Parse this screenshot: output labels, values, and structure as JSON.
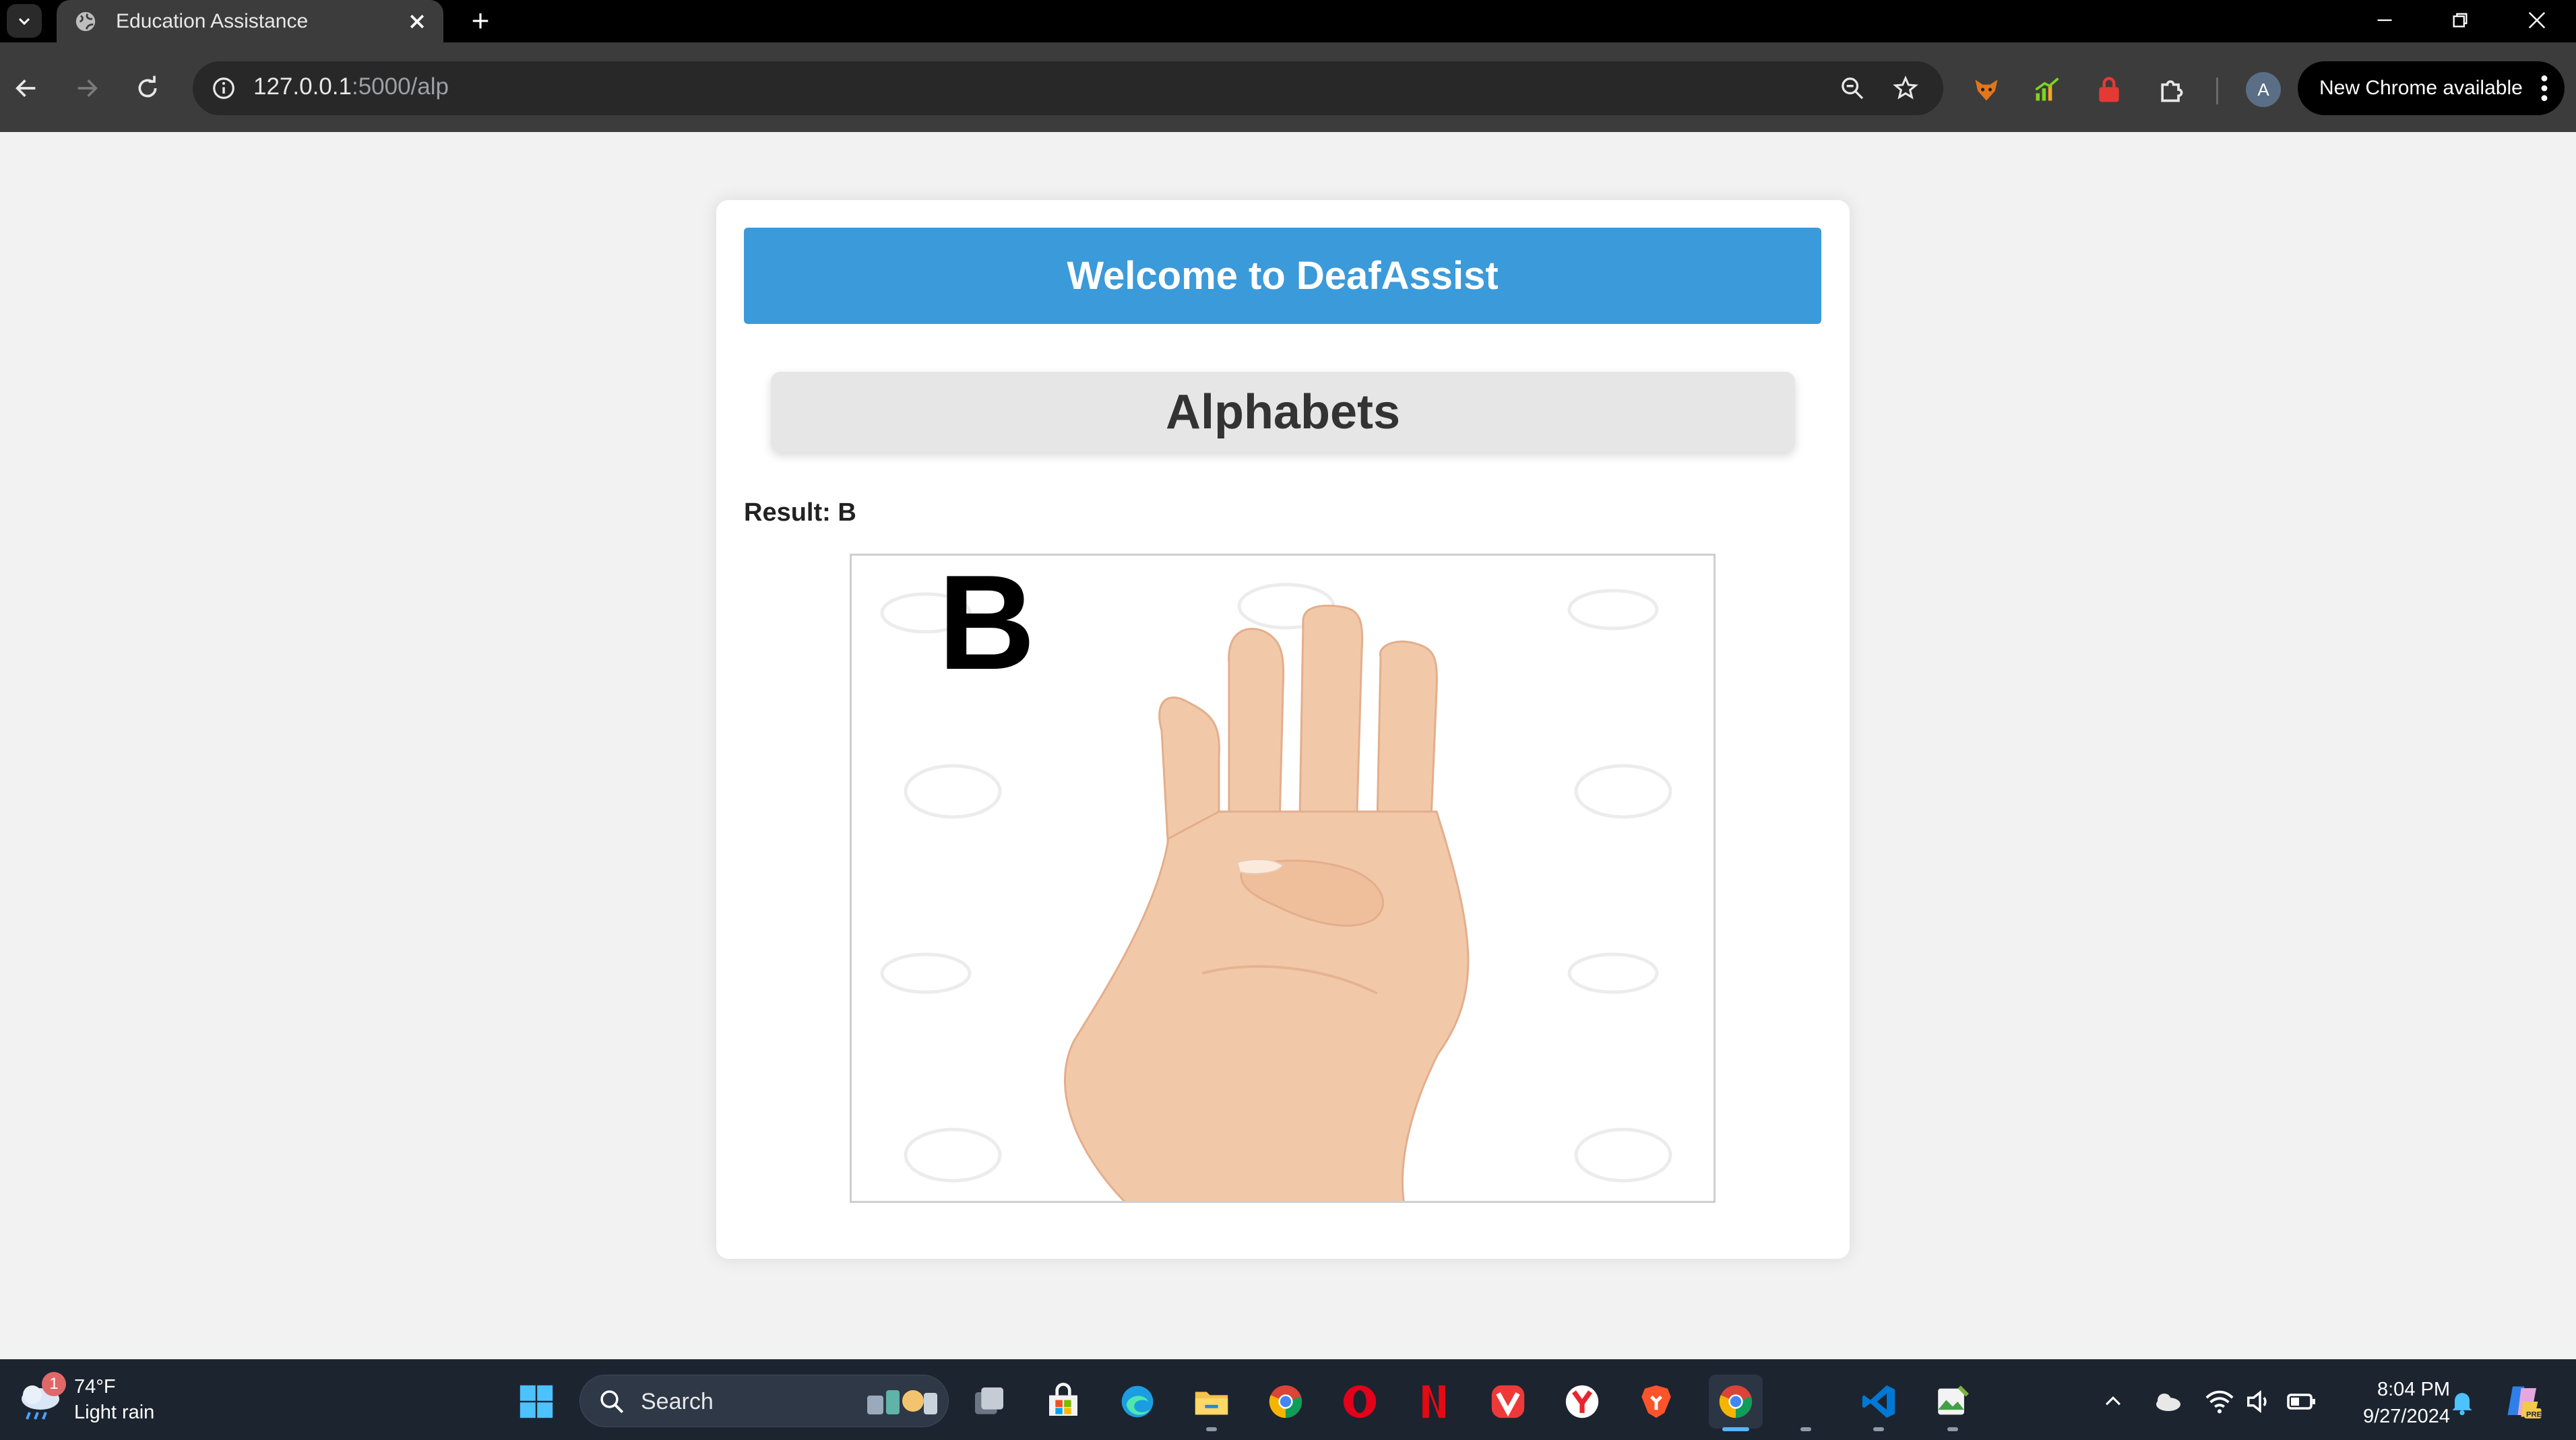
{
  "browser": {
    "tab_title": "Education Assistance",
    "url_host": "127.0.0.1",
    "url_path": ":5000/alp",
    "update_label": "New Chrome available",
    "profile_initial": "A"
  },
  "page": {
    "banner": "Welcome to DeafAssist",
    "section_button": "Alphabets",
    "result_label": "Result: B",
    "sign_letter": "B"
  },
  "taskbar": {
    "weather_temp": "74°F",
    "weather_desc": "Light rain",
    "weather_badge": "1",
    "search_placeholder": "Search",
    "time": "8:04 PM",
    "date": "9/27/2024"
  },
  "colors": {
    "banner_bg": "#3b9ad9",
    "page_bg": "#f2f2f2",
    "card_bg": "#ffffff",
    "section_button_bg": "#e6e6e6"
  }
}
